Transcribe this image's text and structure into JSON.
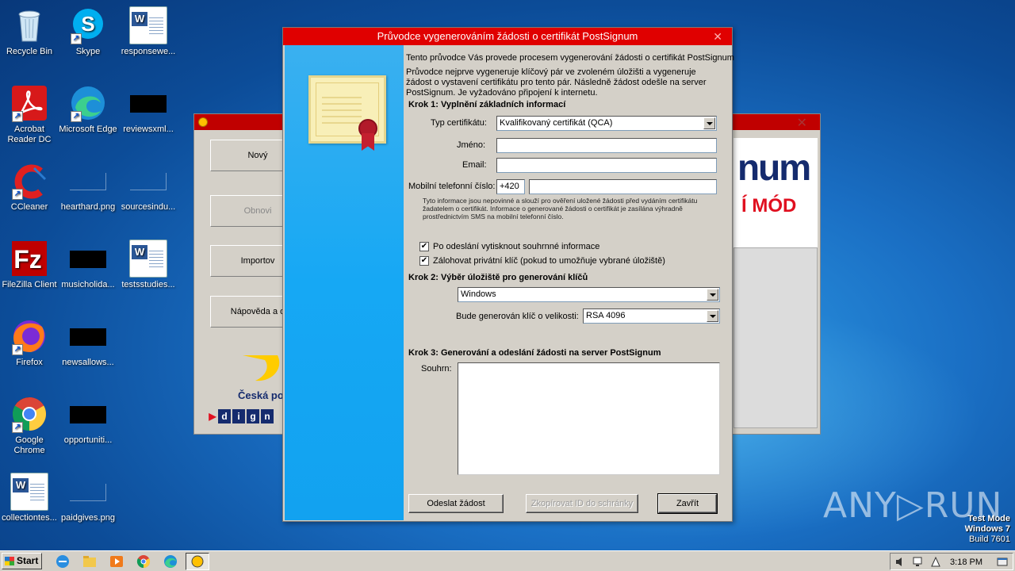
{
  "desktop": {
    "icons": [
      {
        "label": "Recycle Bin",
        "icon": "recycle-bin-icon"
      },
      {
        "label": "Skype",
        "icon": "skype-icon"
      },
      {
        "label": "responsewe...",
        "icon": "word-doc-icon"
      },
      {
        "label": "Acrobat Reader DC",
        "icon": "acrobat-icon"
      },
      {
        "label": "Microsoft Edge",
        "icon": "edge-icon"
      },
      {
        "label": "reviewsxml...",
        "icon": "file-icon"
      },
      {
        "label": "CCleaner",
        "icon": "ccleaner-icon"
      },
      {
        "label": "hearthard.png",
        "icon": "image-file-icon"
      },
      {
        "label": "sourcesindu...",
        "icon": "file-icon"
      },
      {
        "label": "FileZilla Client",
        "icon": "filezilla-icon"
      },
      {
        "label": "musicholida...",
        "icon": "file-icon"
      },
      {
        "label": "testsstudies...",
        "icon": "word-doc-icon"
      },
      {
        "label": "Firefox",
        "icon": "firefox-icon"
      },
      {
        "label": "newsallows...",
        "icon": "file-icon"
      },
      {
        "label": "Google Chrome",
        "icon": "chrome-icon"
      },
      {
        "label": "opportuniti...",
        "icon": "file-icon"
      },
      {
        "label": "collectiontes...",
        "icon": "word-doc-icon"
      },
      {
        "label": "paidgives.png",
        "icon": "image-file-icon"
      }
    ]
  },
  "background_window": {
    "buttons": [
      "Nový",
      "Obnovi",
      "Importov",
      "Nápověda a o"
    ],
    "brand_text": "num",
    "mode_text": "Í MÓD",
    "logo_text": "Česká po",
    "dign": [
      "d",
      "i",
      "g",
      "n"
    ]
  },
  "dialog": {
    "title": "Průvodce vygenerováním žádosti o certifikát PostSignum",
    "intro": "Tento průvodce Vás provede procesem vygenerování žádosti o certifikát PostSignum",
    "description": "Průvodce nejprve vygeneruje klíčový pár ve zvoleném úložišti a vygeneruje žádost o vystavení certifikátu pro tento pár. Následně žádost odešle na server PostSignum. Je vyžadováno připojení k internetu.",
    "step1": {
      "heading": "Krok 1: Vyplnění základních informací",
      "cert_type_label": "Typ certifikátu:",
      "cert_type_value": "Kvalifikovaný certifikát (QCA)",
      "name_label": "Jméno:",
      "name_value": "",
      "email_label": "Email:",
      "email_value": "",
      "phone_label": "Mobilní telefonní číslo:",
      "phone_prefix": "+420",
      "phone_value": "",
      "info_note": "Tyto informace jsou nepovinné a slouží pro ověření uložené žádosti před vydáním certifikátu žadatelem o certifikát. Informace o generované žádosti o certifikát je zasílána výhradně prostřednictvím SMS na mobilní telefonní číslo.",
      "print_summary_label": "Po odeslání vytisknout souhrnné informace",
      "print_summary_checked": true,
      "backup_key_label": "Zálohovat privátní klíč (pokud to umožňuje vybrané úložiště)",
      "backup_key_checked": true
    },
    "step2": {
      "heading": "Krok 2: Výběr úložiště pro generování klíčů",
      "storage_value": "Windows",
      "key_size_label": "Bude generován klíč o velikosti:",
      "key_size_value": "RSA 4096"
    },
    "step3": {
      "heading": "Krok 3: Generování a odeslání žádosti na server PostSignum",
      "summary_label": "Souhrn:",
      "summary_value": ""
    },
    "buttons": {
      "send": "Odeslat žádost",
      "copy_id": "Zkopírovat ID do schránky",
      "close": "Zavřít"
    }
  },
  "watermark": {
    "brand": "ANY▷RUN",
    "test_mode": "Test Mode",
    "os": "Windows 7",
    "build": "Build 7601"
  },
  "taskbar": {
    "start_label": "Start",
    "clock": "3:18 PM"
  },
  "colors": {
    "title_red": "#e00000",
    "side_blue": "#16a8f4",
    "dialog_bg": "#d4d0c8"
  }
}
